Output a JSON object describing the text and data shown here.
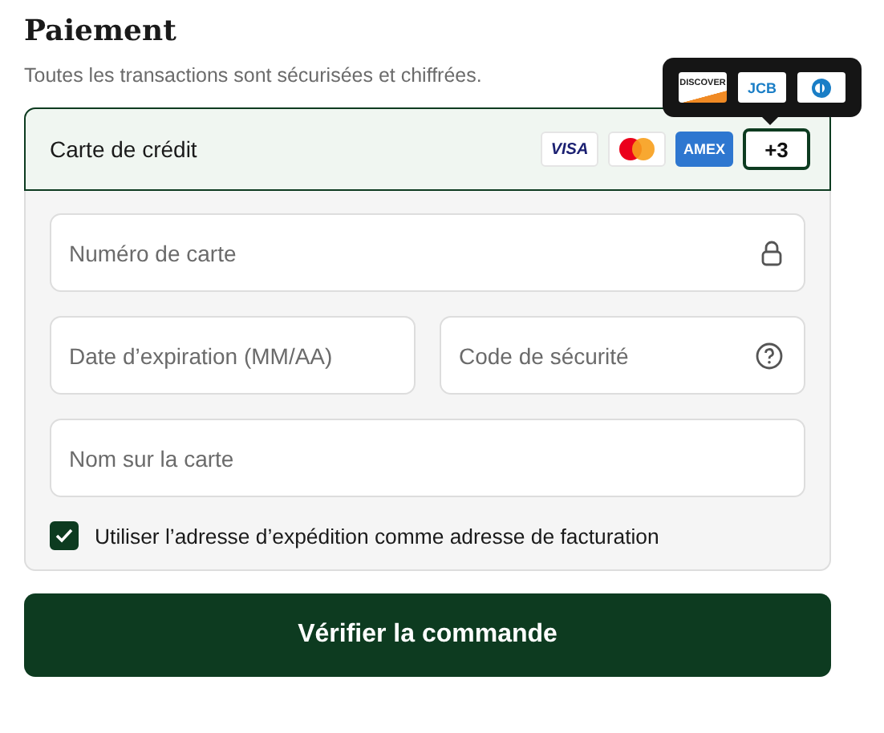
{
  "title": "Paiement",
  "subtitle": "Toutes les transactions sont sécurisées et chiffrées.",
  "method": {
    "label": "Carte de crédit",
    "selected": true,
    "cards": [
      {
        "kind": "visa",
        "label": "VISA"
      },
      {
        "kind": "mastercard"
      },
      {
        "kind": "amex",
        "label": "AMEX"
      }
    ],
    "more": {
      "label": "+3",
      "expanded": true
    },
    "tooltip_cards": [
      {
        "kind": "discover",
        "label": "DISCOVER"
      },
      {
        "kind": "jcb",
        "label": "JCB"
      },
      {
        "kind": "diners"
      }
    ]
  },
  "fields": [
    {
      "placeholder": "Numéro de carte"
    },
    {
      "placeholder": "Date d’expiration (MM/AA)"
    },
    {
      "placeholder": "Code de sécurité"
    },
    {
      "placeholder": "Nom sur la carte"
    }
  ],
  "billing_checkbox": {
    "label": "Utiliser l’adresse d’expédition comme adresse de facturation",
    "checked": true
  },
  "submit": {
    "label": "Vérifier la commande"
  }
}
